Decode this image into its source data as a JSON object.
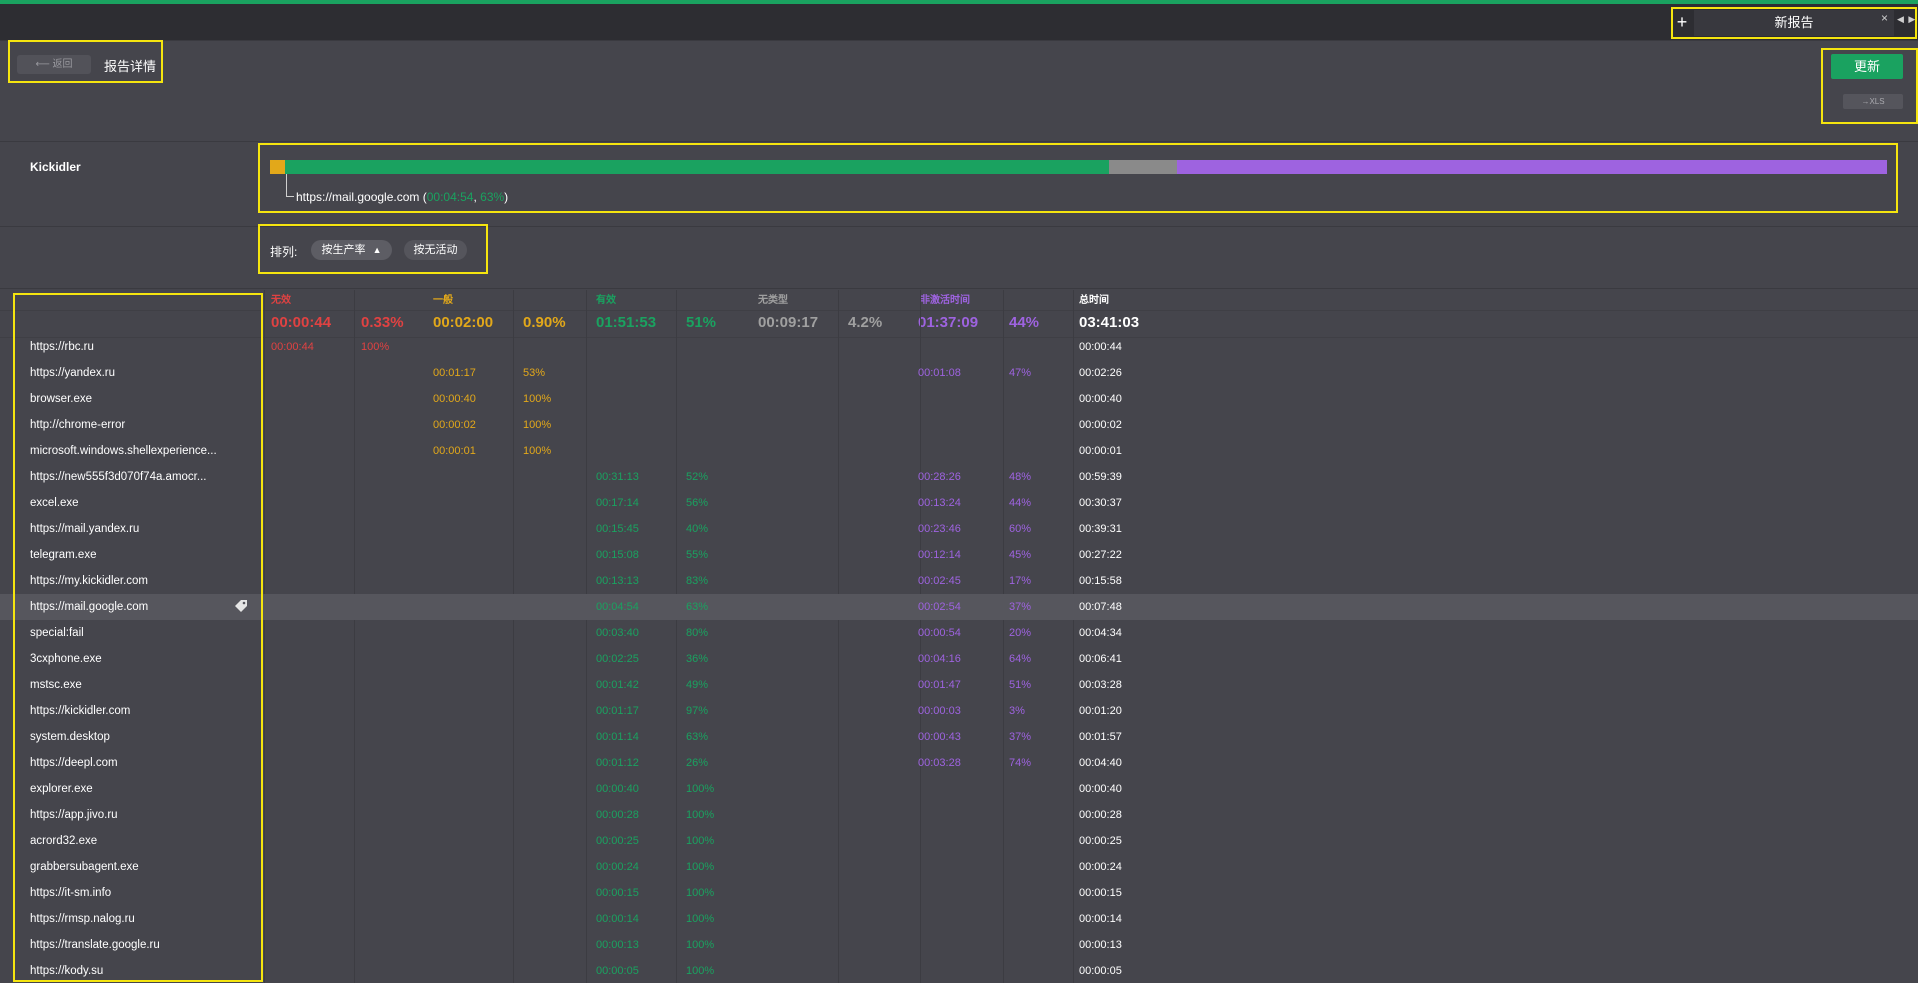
{
  "tabs": {
    "add_icon": "+",
    "active_label": "新报告",
    "close_icon": "×",
    "nav_icon": "◀ ▶"
  },
  "header": {
    "back_label": "⟵ 返回",
    "title": "报告详情",
    "update_label": "更新",
    "xls_label": "→XLS"
  },
  "entity": "Kickidler",
  "bar": {
    "segments": [
      {
        "color": "#e2a81a",
        "fraction": 0.009
      },
      {
        "color": "#1aa260",
        "fraction": 0.51
      },
      {
        "color": "#8a8a8a",
        "fraction": 0.042
      },
      {
        "color": "#9e63e0",
        "fraction": 0.44
      }
    ],
    "caption_url": "https://mail.google.com",
    "caption_time": "00:04:54",
    "caption_pct": "63%"
  },
  "sort": {
    "label": "排列:",
    "by_productivity": "按生产率",
    "by_inactivity": "按无活动"
  },
  "columns": {
    "unproductive": "无效",
    "neutral": "一般",
    "productive": "有效",
    "uncategorized": "无类型",
    "inactive": "非激活时间",
    "total": "总时间"
  },
  "totals": {
    "unproductive_time": "00:00:44",
    "unproductive_pct": "0.33%",
    "neutral_time": "00:02:00",
    "neutral_pct": "0.90%",
    "productive_time": "01:51:53",
    "productive_pct": "51%",
    "uncategorized_time": "00:09:17",
    "uncategorized_pct": "4.2%",
    "inactive_time": "01:37:09",
    "inactive_pct": "44%",
    "total_time": "03:41:03"
  },
  "rows": [
    {
      "name": "https://rbc.ru",
      "unprod": [
        "00:00:44",
        "100%"
      ],
      "neutral": null,
      "prod": null,
      "inactive": null,
      "total": "00:00:44"
    },
    {
      "name": "https://yandex.ru",
      "unprod": null,
      "neutral": [
        "00:01:17",
        "53%"
      ],
      "prod": null,
      "inactive": [
        "00:01:08",
        "47%"
      ],
      "total": "00:02:26"
    },
    {
      "name": "browser.exe",
      "unprod": null,
      "neutral": [
        "00:00:40",
        "100%"
      ],
      "prod": null,
      "inactive": null,
      "total": "00:00:40"
    },
    {
      "name": "http://chrome-error",
      "unprod": null,
      "neutral": [
        "00:00:02",
        "100%"
      ],
      "prod": null,
      "inactive": null,
      "total": "00:00:02"
    },
    {
      "name": "microsoft.windows.shellexperience...",
      "unprod": null,
      "neutral": [
        "00:00:01",
        "100%"
      ],
      "prod": null,
      "inactive": null,
      "total": "00:00:01"
    },
    {
      "name": "https://new555f3d070f74a.amocr...",
      "unprod": null,
      "neutral": null,
      "prod": [
        "00:31:13",
        "52%"
      ],
      "inactive": [
        "00:28:26",
        "48%"
      ],
      "total": "00:59:39"
    },
    {
      "name": "excel.exe",
      "unprod": null,
      "neutral": null,
      "prod": [
        "00:17:14",
        "56%"
      ],
      "inactive": [
        "00:13:24",
        "44%"
      ],
      "total": "00:30:37"
    },
    {
      "name": "https://mail.yandex.ru",
      "unprod": null,
      "neutral": null,
      "prod": [
        "00:15:45",
        "40%"
      ],
      "inactive": [
        "00:23:46",
        "60%"
      ],
      "total": "00:39:31"
    },
    {
      "name": "telegram.exe",
      "unprod": null,
      "neutral": null,
      "prod": [
        "00:15:08",
        "55%"
      ],
      "inactive": [
        "00:12:14",
        "45%"
      ],
      "total": "00:27:22"
    },
    {
      "name": "https://my.kickidler.com",
      "unprod": null,
      "neutral": null,
      "prod": [
        "00:13:13",
        "83%"
      ],
      "inactive": [
        "00:02:45",
        "17%"
      ],
      "total": "00:15:58"
    },
    {
      "name": "https://mail.google.com",
      "unprod": null,
      "neutral": null,
      "prod": [
        "00:04:54",
        "63%"
      ],
      "inactive": [
        "00:02:54",
        "37%"
      ],
      "total": "00:07:48",
      "highlight": true
    },
    {
      "name": "special:fail",
      "unprod": null,
      "neutral": null,
      "prod": [
        "00:03:40",
        "80%"
      ],
      "inactive": [
        "00:00:54",
        "20%"
      ],
      "total": "00:04:34"
    },
    {
      "name": "3cxphone.exe",
      "unprod": null,
      "neutral": null,
      "prod": [
        "00:02:25",
        "36%"
      ],
      "inactive": [
        "00:04:16",
        "64%"
      ],
      "total": "00:06:41"
    },
    {
      "name": "mstsc.exe",
      "unprod": null,
      "neutral": null,
      "prod": [
        "00:01:42",
        "49%"
      ],
      "inactive": [
        "00:01:47",
        "51%"
      ],
      "total": "00:03:28"
    },
    {
      "name": "https://kickidler.com",
      "unprod": null,
      "neutral": null,
      "prod": [
        "00:01:17",
        "97%"
      ],
      "inactive": [
        "00:00:03",
        "3%"
      ],
      "total": "00:01:20"
    },
    {
      "name": "system.desktop",
      "unprod": null,
      "neutral": null,
      "prod": [
        "00:01:14",
        "63%"
      ],
      "inactive": [
        "00:00:43",
        "37%"
      ],
      "total": "00:01:57"
    },
    {
      "name": "https://deepl.com",
      "unprod": null,
      "neutral": null,
      "prod": [
        "00:01:12",
        "26%"
      ],
      "inactive": [
        "00:03:28",
        "74%"
      ],
      "total": "00:04:40"
    },
    {
      "name": "explorer.exe",
      "unprod": null,
      "neutral": null,
      "prod": [
        "00:00:40",
        "100%"
      ],
      "inactive": null,
      "total": "00:00:40"
    },
    {
      "name": "https://app.jivo.ru",
      "unprod": null,
      "neutral": null,
      "prod": [
        "00:00:28",
        "100%"
      ],
      "inactive": null,
      "total": "00:00:28"
    },
    {
      "name": "acrord32.exe",
      "unprod": null,
      "neutral": null,
      "prod": [
        "00:00:25",
        "100%"
      ],
      "inactive": null,
      "total": "00:00:25"
    },
    {
      "name": "grabbersubagent.exe",
      "unprod": null,
      "neutral": null,
      "prod": [
        "00:00:24",
        "100%"
      ],
      "inactive": null,
      "total": "00:00:24"
    },
    {
      "name": "https://it-sm.info",
      "unprod": null,
      "neutral": null,
      "prod": [
        "00:00:15",
        "100%"
      ],
      "inactive": null,
      "total": "00:00:15"
    },
    {
      "name": "https://rmsp.nalog.ru",
      "unprod": null,
      "neutral": null,
      "prod": [
        "00:00:14",
        "100%"
      ],
      "inactive": null,
      "total": "00:00:14"
    },
    {
      "name": "https://translate.google.ru",
      "unprod": null,
      "neutral": null,
      "prod": [
        "00:00:13",
        "100%"
      ],
      "inactive": null,
      "total": "00:00:13"
    },
    {
      "name": "https://kody.su",
      "unprod": null,
      "neutral": null,
      "prod": [
        "00:00:05",
        "100%"
      ],
      "inactive": null,
      "total": "00:00:05"
    }
  ],
  "row_tag_icon": "tag-icon"
}
